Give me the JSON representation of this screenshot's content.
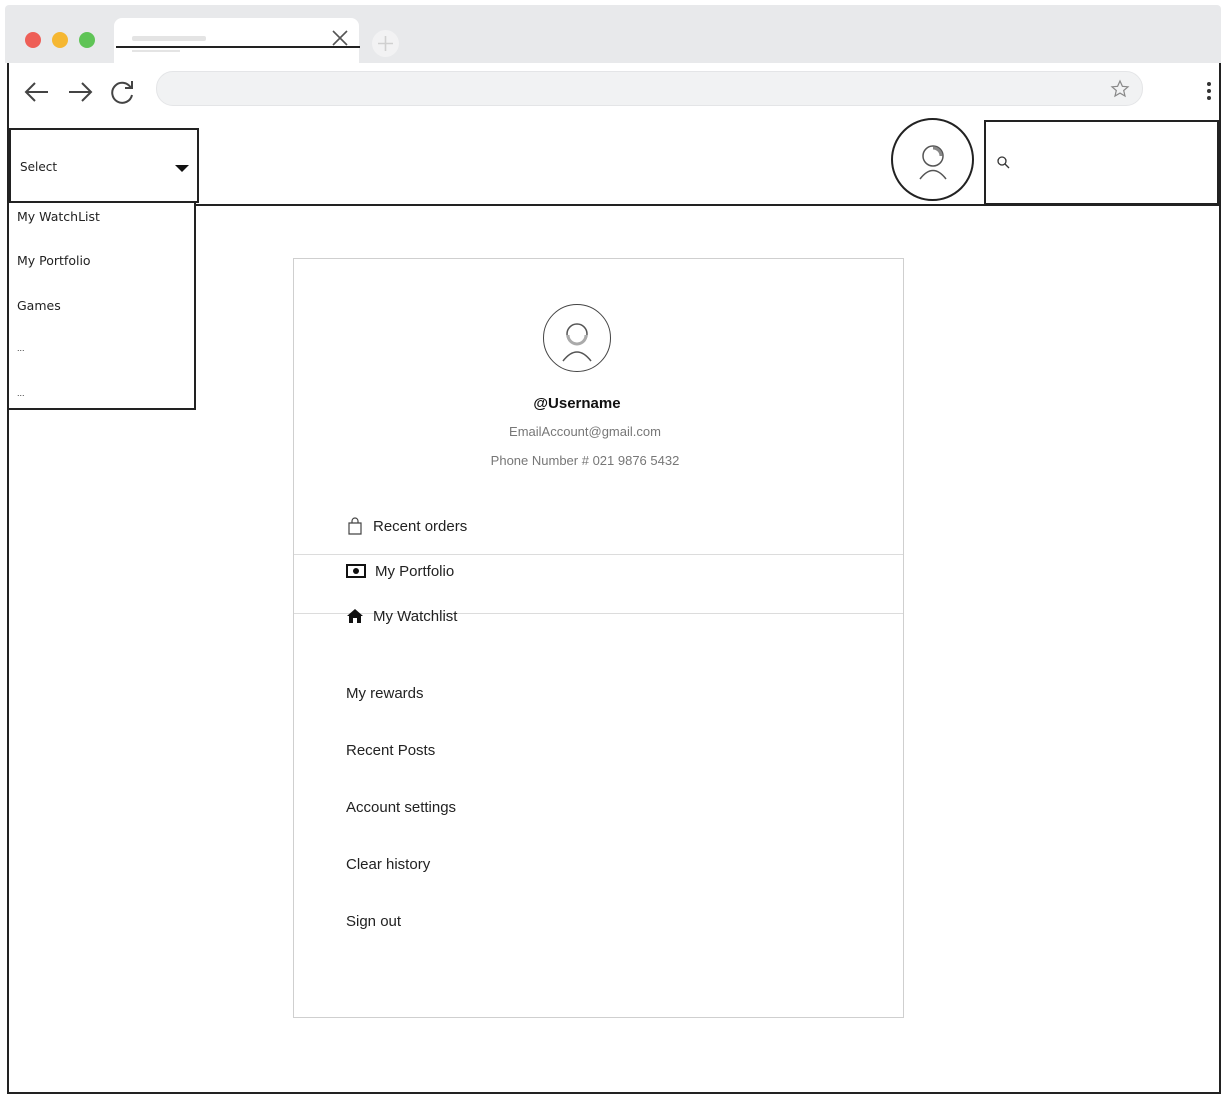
{
  "header": {
    "select": {
      "label": "Select"
    },
    "dropdown_items": [
      "My WatchList",
      "My Portfolio",
      "Games",
      "...",
      "..."
    ]
  },
  "profile": {
    "username": "@Username",
    "email": "EmailAccount@gmail.com",
    "phone": "Phone Number # 021 9876 5432"
  },
  "menu": {
    "primary": [
      {
        "label": "Recent orders",
        "icon": "shopping-bag-icon"
      },
      {
        "label": "My Portfolio",
        "icon": "money-icon"
      },
      {
        "label": "My Watchlist",
        "icon": "home-icon"
      }
    ],
    "secondary": [
      "My rewards",
      "Recent Posts",
      "Account settings",
      "Clear history",
      "Sign out"
    ]
  }
}
